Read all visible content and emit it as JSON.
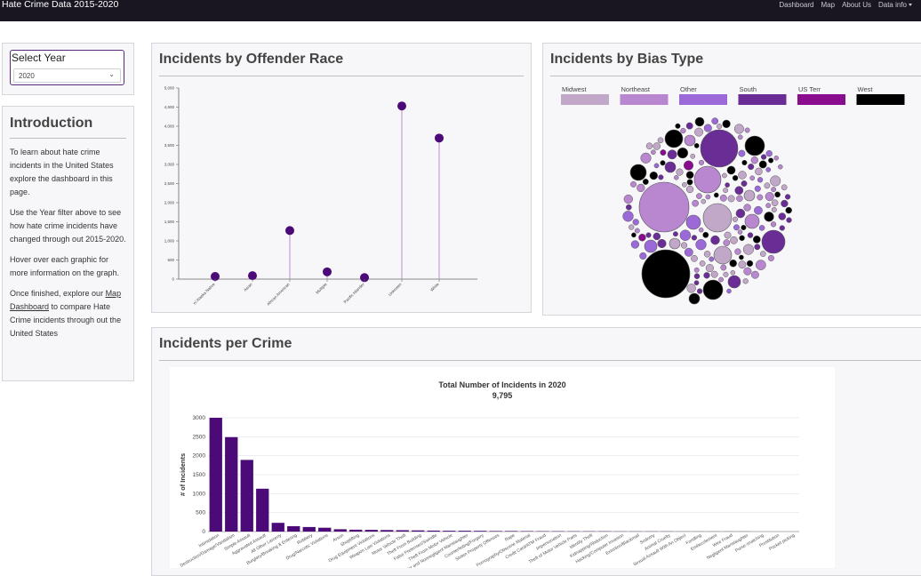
{
  "navbar": {
    "brand": "Hate Crime Data 2015-2020",
    "links": [
      "Dashboard",
      "Map",
      "About Us",
      "Data info"
    ]
  },
  "year_select": {
    "label": "Select Year",
    "value": "2020"
  },
  "intro": {
    "title": "Introduction",
    "p1": "To learn about hate crime incidents in the United States explore the dashboard in this page.",
    "p2": "Use the Year filter above to see how hate crime incidents have changed through out 2015-2020.",
    "p3": "Hover over each graphic for more information on the graph.",
    "p4_before": "Once finished, explore our ",
    "p4_link": "Map Dashboard",
    "p4_after": " to compare Hate Crime incidents through out the United States"
  },
  "offender_race": {
    "title": "Incidents by Offender Race"
  },
  "bias_type": {
    "title": "Incidents by Bias Type",
    "legend": [
      {
        "label": "Midwest",
        "color": "#c2a8c8"
      },
      {
        "label": "Northeast",
        "color": "#b887cf"
      },
      {
        "label": "Other",
        "color": "#9b6ad8"
      },
      {
        "label": "South",
        "color": "#6a2d96"
      },
      {
        "label": "US Terr",
        "color": "#8a0c8e"
      },
      {
        "label": "West",
        "color": "#000000"
      }
    ]
  },
  "per_crime": {
    "title": "Incidents per Crime",
    "chart_title": "Total Number of Incidents in 2020",
    "total": "9,795"
  },
  "chart_data": [
    {
      "type": "scatter",
      "subtype": "lollipop",
      "categories": [
        "Am. Indian or Alaska Native",
        "Asian",
        "Black or African American",
        "Multiple",
        "Native Hawaiian or Other Pacific Islander",
        "Unknown",
        "White"
      ],
      "tick_labels": [
        "n/ Alaska Native",
        "Asian",
        "African American",
        "Multiple",
        "Pacific Islander",
        "Unknown",
        "White"
      ],
      "values": [
        70,
        90,
        1270,
        190,
        40,
        4530,
        3690
      ],
      "yticks": [
        "0",
        "500",
        "1,000",
        "1,500",
        "2,000",
        "2,500",
        "3,000",
        "3,500",
        "4,000",
        "4,500",
        "5,000"
      ],
      "ylim": [
        0,
        5000
      ],
      "color": "#4b0a78",
      "stem_color": "#c9a0d8"
    },
    {
      "type": "bar",
      "title": "Total Number of Incidents in 2020",
      "subtitle": "9,795",
      "ylabel": "# of Incidents",
      "ylim": [
        0,
        3000
      ],
      "yticks": [
        "0",
        "500",
        "1000",
        "1500",
        "2000",
        "2500",
        "3000"
      ],
      "color": "#4b0a78",
      "categories": [
        "Intimidation",
        "Destruction/Damage/Vandalism",
        "Simple Assault",
        "Aggravated Assault",
        "All Other Larceny",
        "Burglary/Breaking & Entering",
        "Robbery",
        "Drug/Narcotic Violations",
        "Arson",
        "Shoplifting",
        "Drug Equipment Violations",
        "Weapon Law Violations",
        "Motor Vehicle Theft",
        "Theft From Building",
        "False Pretenses/Swindle",
        "Theft From Motor Vehicle",
        "Murder and Nonnegligent Manslaughter",
        "Counterfeiting/Forgery",
        "Stolen Property Offenses",
        "Rape",
        "Pornography/Obscene Material",
        "Credit Card/ATM Fraud",
        "Impersonation",
        "Theft of Motor Vehicle Parts",
        "Identity Theft",
        "Kidnapping/Abduction",
        "Hacking/Computer Invasion",
        "Extortion/Blackmail",
        "Sodomy",
        "Animal Cruelty",
        "Sexual Assault With An Object",
        "Fondling",
        "Embezzlement",
        "Wire Fraud",
        "Negligent Manslaughter",
        "Purse-snatching",
        "Prostitution",
        "Pocket-picking"
      ],
      "values": [
        3000,
        2490,
        1890,
        1130,
        230,
        140,
        120,
        100,
        60,
        50,
        45,
        40,
        35,
        30,
        25,
        22,
        20,
        18,
        15,
        14,
        12,
        10,
        9,
        8,
        7,
        6,
        5,
        5,
        4,
        4,
        3,
        3,
        2,
        2,
        2,
        1,
        1,
        1
      ]
    }
  ]
}
